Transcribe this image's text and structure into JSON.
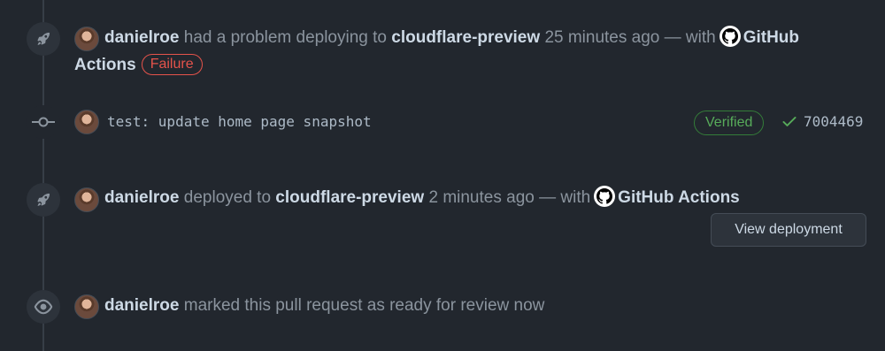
{
  "events": [
    {
      "icon": "rocket-icon",
      "author": "danielroe",
      "text1": "had a problem deploying to",
      "environment": "cloudflare-preview",
      "time": "25 minutes ago — with",
      "app_first": "GitHub",
      "app_second": "Actions",
      "status": "Failure"
    },
    {
      "icon": "commit-icon",
      "message": "test: update home page snapshot",
      "verified_label": "Verified",
      "sha": "7004469"
    },
    {
      "icon": "rocket-icon",
      "author": "danielroe",
      "text1": "deployed to",
      "environment": "cloudflare-preview",
      "time": "2 minutes ago — with",
      "app": "GitHub Actions",
      "button": "View deployment"
    },
    {
      "icon": "eye-icon",
      "author": "danielroe",
      "text1": "marked this pull request as ready for review now"
    }
  ],
  "colors": {
    "background": "#22272e",
    "failure": "#e5534b",
    "verified": "#57ab5a"
  }
}
